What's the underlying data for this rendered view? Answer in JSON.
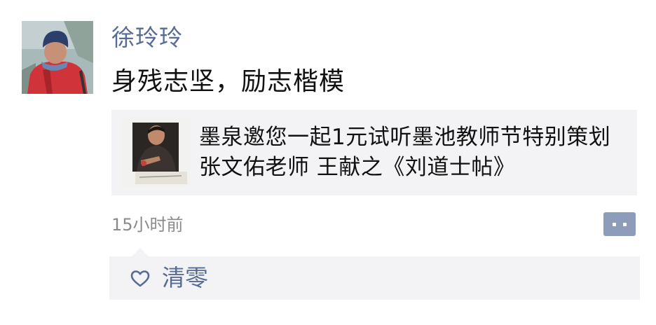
{
  "post": {
    "author": "徐玲玲",
    "text": "身残志坚，励志楷模",
    "time": "15小时前"
  },
  "link_card": {
    "title": "墨泉邀您一起1元试听墨池教师节特别策划 张文佑老师 王献之《刘道士帖》"
  },
  "likes": {
    "names": "清零"
  },
  "icons": {
    "avatar": "avatar-photo",
    "thumbnail": "link-thumbnail-photo",
    "action": "comment-more-icon",
    "like": "heart-icon"
  },
  "colors": {
    "name_link": "#576b95",
    "card_bg": "#f3f3f5",
    "action_btn": "#8e9cbc",
    "time_text": "#8a8a8a"
  }
}
